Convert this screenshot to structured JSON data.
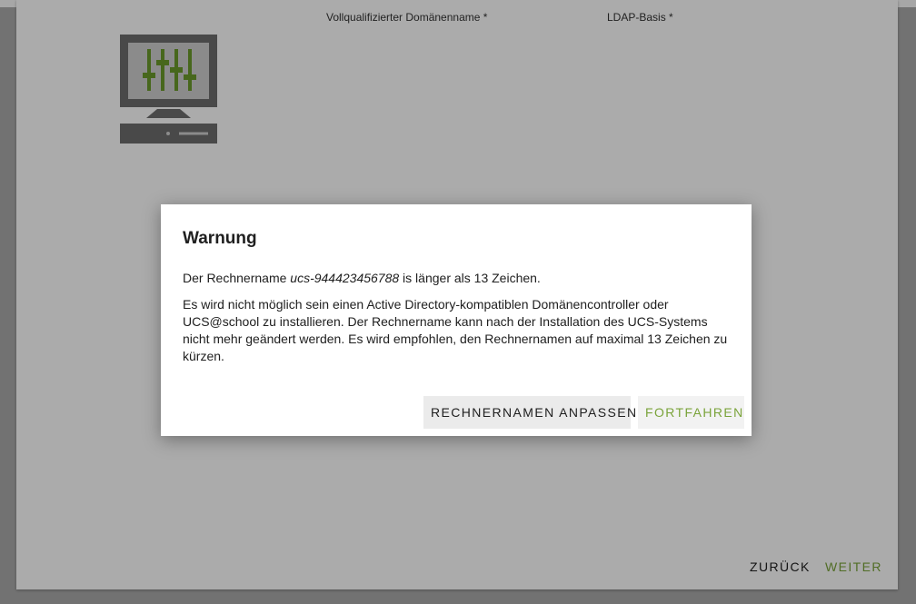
{
  "wizard": {
    "fields": {
      "fqdn_label": "Vollqualifizierter Domänenname *",
      "ldap_label": "LDAP-Basis *"
    },
    "footer": {
      "back_label": "ZURÜCK",
      "next_label": "WEITER"
    },
    "icon": "server-settings-icon"
  },
  "dialog": {
    "title": "Warnung",
    "message1_prefix": "Der Rechnername ",
    "hostname": "ucs-944423456788",
    "message1_suffix": " is länger als 13 Zeichen.",
    "message2": "Es wird nicht möglich sein einen Active Directory-kompatiblen Domänencontroller oder UCS@school zu installieren. Der Rechnername kann nach der Installation des UCS-Systems nicht mehr geändert werden. Es wird empfohlen, den Rechnernamen auf maximal 13 Zeichen zu kürzen.",
    "adjust_label": "RECHNERNAMEN ANPASSEN",
    "continue_label": "FORTFAHREN"
  },
  "colors": {
    "accent_green": "#7aa33a",
    "icon_gray": "#6e6e6e"
  }
}
